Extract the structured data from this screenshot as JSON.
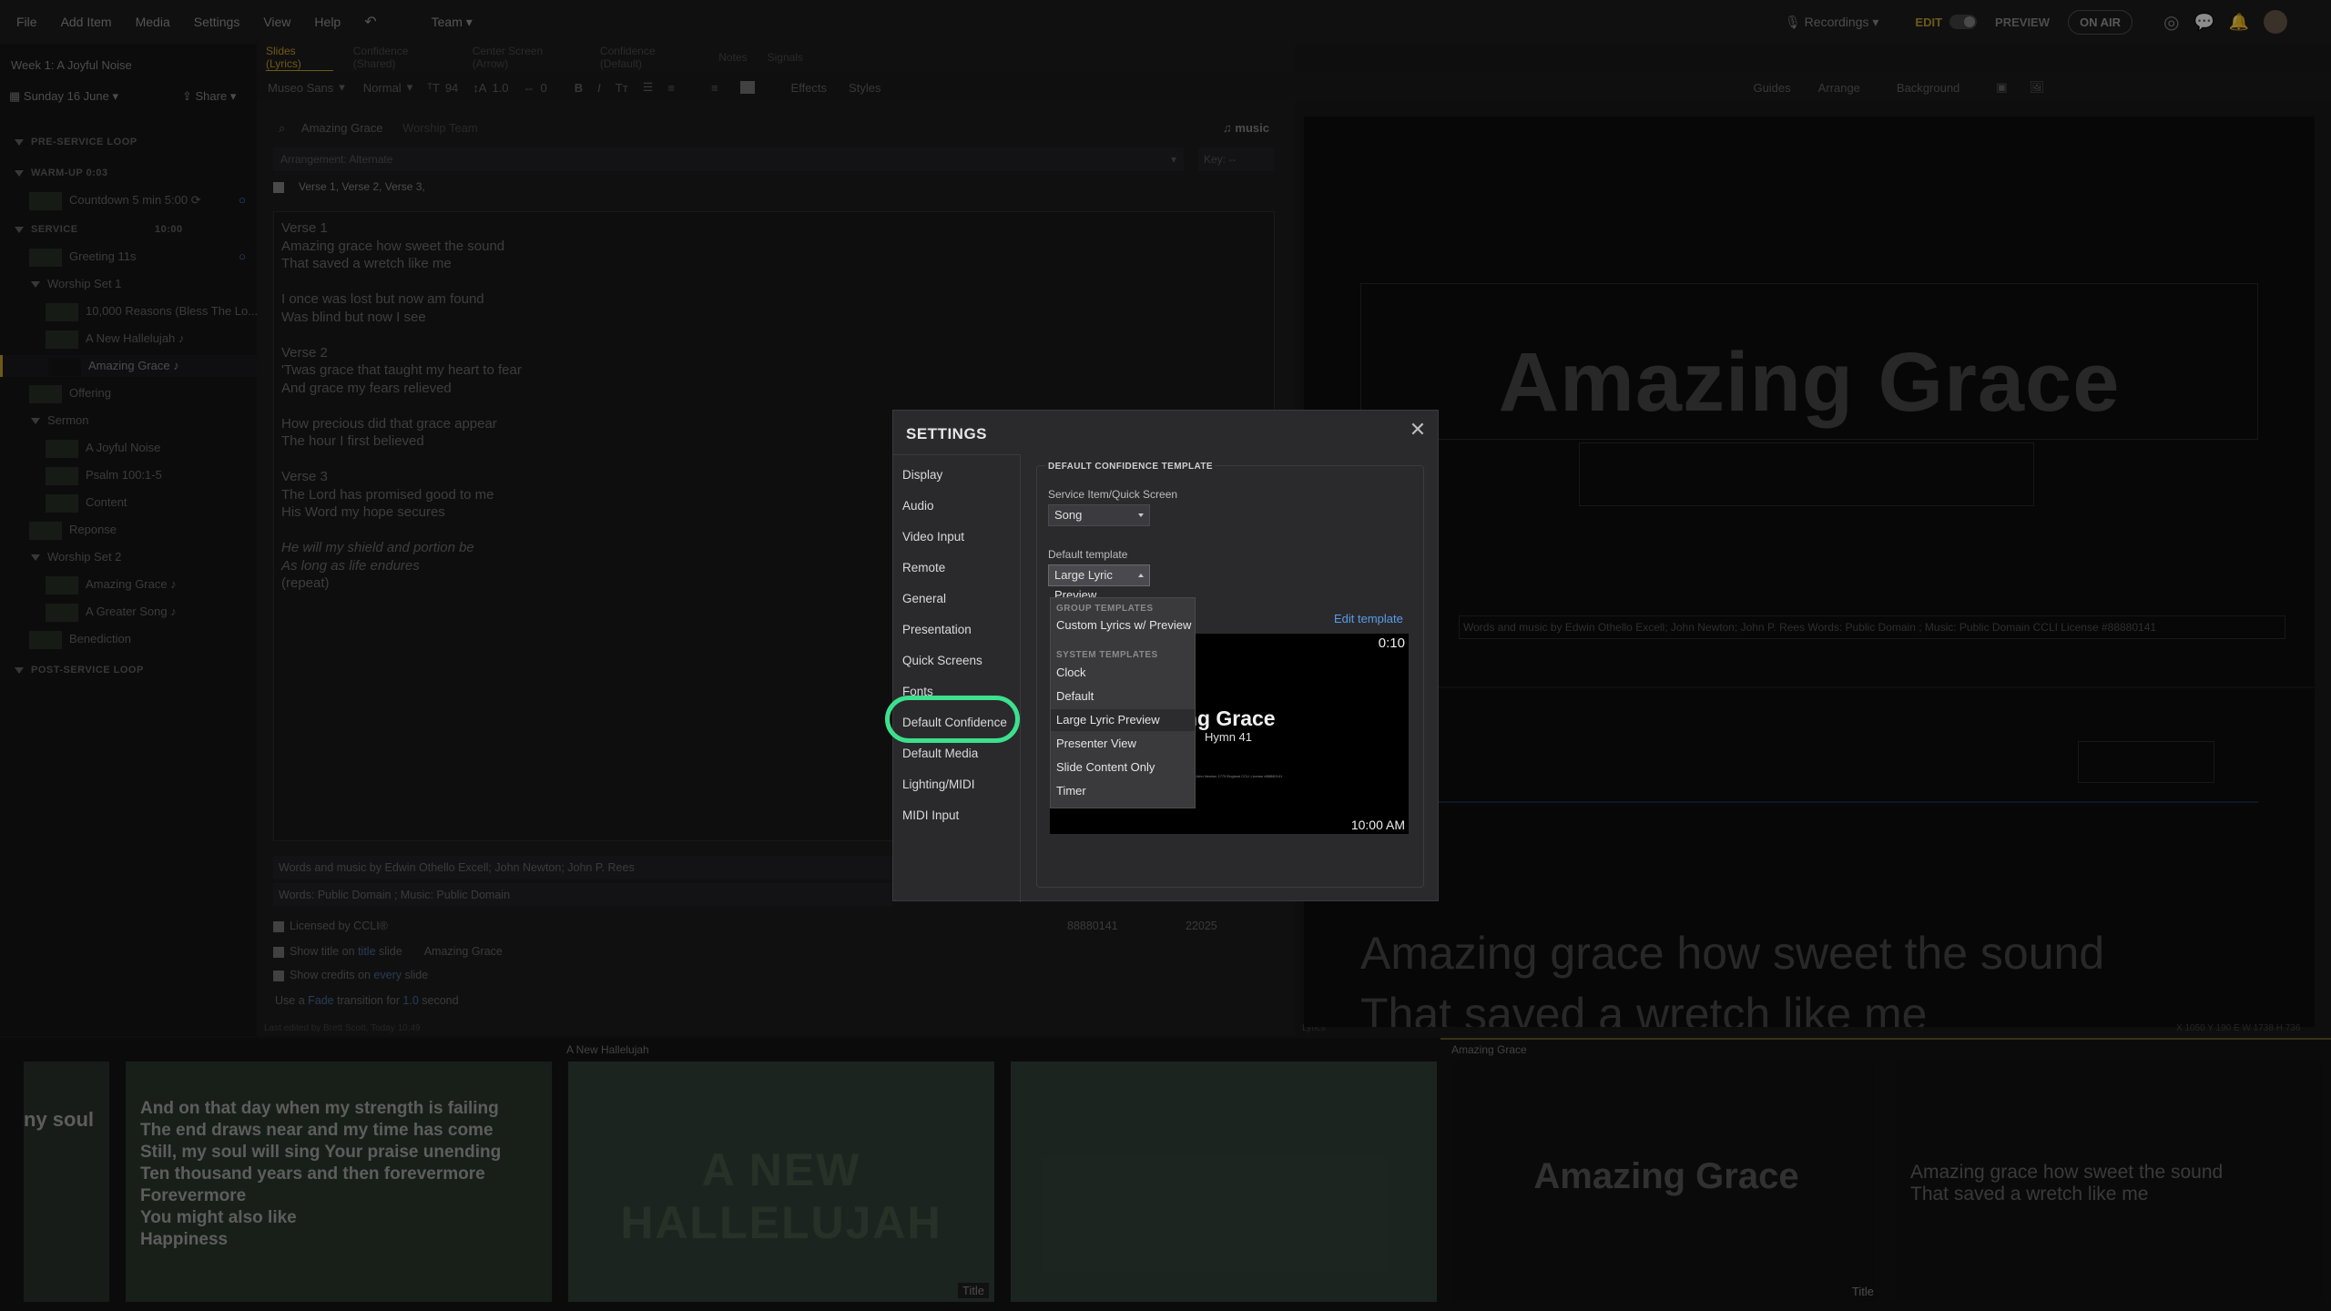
{
  "menu": [
    "File",
    "Add Item",
    "Media",
    "Settings",
    "View",
    "Help"
  ],
  "team": "Team",
  "topright": {
    "recordings": "Recordings",
    "edit": "EDIT",
    "preview": "PREVIEW",
    "onair": "ON AIR"
  },
  "plan": {
    "title": "Week 1: A Joyful Noise",
    "date": "Sunday 16 June",
    "share": "Share"
  },
  "sidebar": {
    "pre": "PRE-SERVICE LOOP",
    "warmup": "WARM-UP",
    "warmup_time": "0:03",
    "countdown": "Countdown 5 min",
    "countdown_time": "5:00",
    "service": "SERVICE",
    "service_time": "10:00",
    "items": [
      "Greeting",
      "Worship Set 1",
      "10,000 Reasons (Bless The Lo...",
      "A New Hallelujah",
      "Amazing Grace",
      "Offering",
      "Sermon",
      "A Joyful Noise",
      "Psalm 100:1-5",
      "Content",
      "Reponse",
      "Worship Set 2",
      "Amazing Grace",
      "A Greater Song",
      "Benediction"
    ],
    "greeting_time": "11s",
    "post": "POST-SERVICE LOOP"
  },
  "editor": {
    "tabs": [
      "Slides (Lyrics)",
      "Confidence (Shared)",
      "Center Screen (Arrow)",
      "Confidence (Default)",
      "Notes",
      "Signals"
    ],
    "font": "Museo Sans",
    "weight": "Normal",
    "size": "94",
    "line": "1.0",
    "spacing": "0",
    "effects": "Effects",
    "styles": "Styles",
    "guides": "Guides",
    "arrange": "Arrange",
    "background": "Background",
    "search": "Amazing Grace",
    "search2": "Worship Team",
    "music": "music",
    "arrangement": "Arrangement: Alternate",
    "key": "Key: --",
    "sections": "Verse 1, Verse 2, Verse 3,",
    "lyrics": [
      "Verse 1",
      "Amazing grace how sweet the sound",
      "That saved a wretch like me",
      "",
      "I once was lost but now am found",
      "Was blind but now I see",
      "",
      "Verse 2",
      "'Twas grace that taught my heart to fear",
      "And grace my fears relieved",
      "",
      "How precious did that grace appear",
      "The hour I first believed",
      "",
      "Verse 3",
      "The Lord has promised good to me",
      "His Word my hope secures",
      "",
      "He will my shield and portion be",
      "As long as life endures",
      "(repeat)"
    ],
    "credit1": "Words and music by Edwin Othello Excell; John Newton; John P. Rees",
    "credit2": "Words: Public Domain ; Music: Public Domain",
    "ccli": "Licensed by CCLI®",
    "ccli_num": "88880141",
    "ccli_num2": "22025",
    "showtitle": "Show title on",
    "title_word": "title",
    "slide_word": "slide",
    "title_val": "Amazing Grace",
    "showcredits": "Show credits on",
    "every_word": "every",
    "use": "Use a",
    "fade": "Fade",
    "trans": "transition for",
    "dur": "1.0",
    "second": "second",
    "lastedit": "Last edited by Brett Scott, Today 10:49",
    "lyricslabel": "Lyrics"
  },
  "preview": {
    "title": "Amazing Grace",
    "footer": "Words and music by Edwin Othello Excell; John Newton; John P. Rees Words: Public Domain ; Music: Public Domain CCLI License #88880141",
    "lyric": "Amazing grace how sweet the sound",
    "lyric2": "That saved a wretch like me",
    "coords": "X 1050 Y 190 E  W 1738 H 736"
  },
  "strip": {
    "t0": "ny soul",
    "t1": [
      "And on that day when my strength is failing",
      "The end draws near and my time has come",
      "Still, my soul will sing Your praise unending",
      "Ten thousand years and then forevermore",
      "Forevermore",
      "You might also like",
      "Happiness"
    ],
    "h2": "A New Hallelujah",
    "t2": "A NEW HALLELUJAH",
    "tag2": "Title",
    "h4": "Amazing Grace",
    "t4": "Amazing Grace",
    "tag4": "Title",
    "t5": [
      "Amazing grace how sweet the sound",
      "That saved a wretch like me"
    ]
  },
  "settings": {
    "title": "SETTINGS",
    "nav": [
      "Display",
      "Audio",
      "Video Input",
      "Remote",
      "General",
      "Presentation",
      "Quick Screens",
      "Fonts",
      "Default Confidence",
      "Default Media",
      "Lighting/MIDI",
      "MIDI Input"
    ],
    "section": "DEFAULT CONFIDENCE TEMPLATE",
    "item_label": "Service Item/Quick Screen",
    "item_value": "Song",
    "tmpl_label": "Default template",
    "tmpl_value": "Large Lyric Preview",
    "edit": "Edit template",
    "dd_group": "GROUP TEMPLATES",
    "dd_group_items": [
      "Custom Lyrics w/ Preview"
    ],
    "dd_system": "SYSTEM TEMPLATES",
    "dd_system_items": [
      "Clock",
      "Default",
      "Large Lyric Preview",
      "Presenter View",
      "Slide Content Only",
      "Timer"
    ],
    "pv_timer": "0:10",
    "pv_title": "zing Grace",
    "pv_sub": "Hymn 41",
    "pv_small": "John Newton 1779 England CCLI License #88880141",
    "pv_clock": "10:00 AM"
  },
  "colors": {
    "highlight": "#3ce08d",
    "accent_blue": "#4a8ee8"
  }
}
